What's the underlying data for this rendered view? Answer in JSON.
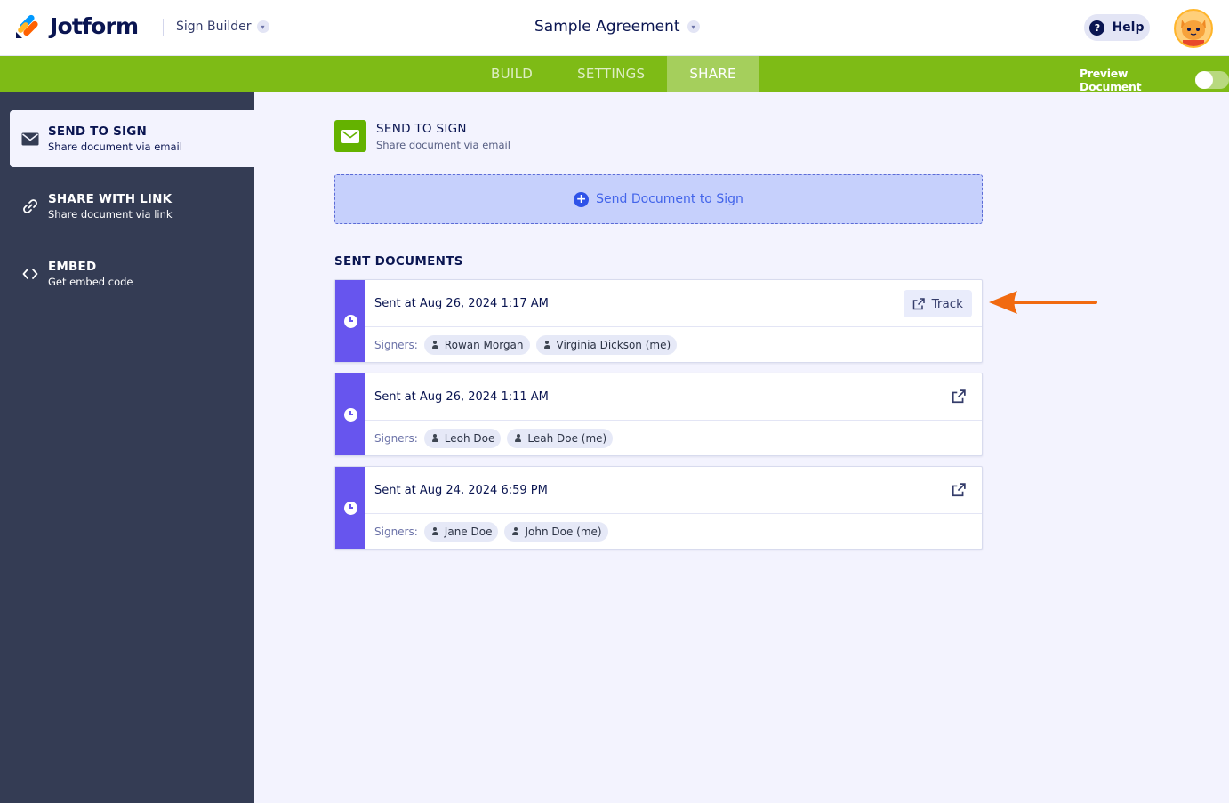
{
  "header": {
    "brand": "Jotform",
    "product": "Sign Builder",
    "document_title": "Sample Agreement",
    "help_label": "Help",
    "avatar_icon": "user-avatar-icon"
  },
  "nav": {
    "tabs": [
      {
        "label": "BUILD",
        "active": false
      },
      {
        "label": "SETTINGS",
        "active": false
      },
      {
        "label": "SHARE",
        "active": true
      }
    ],
    "preview_label": "Preview Document",
    "preview_on": false
  },
  "sidebar": {
    "items": [
      {
        "title": "SEND TO SIGN",
        "subtitle": "Share document via email",
        "icon": "envelope-icon",
        "active": true
      },
      {
        "title": "SHARE WITH LINK",
        "subtitle": "Share document via link",
        "icon": "link-icon",
        "active": false
      },
      {
        "title": "EMBED",
        "subtitle": "Get embed code",
        "icon": "code-icon",
        "active": false
      }
    ]
  },
  "main": {
    "section_title": "SEND TO SIGN",
    "section_subtitle": "Share document via email",
    "send_button_label": "Send Document to Sign",
    "sent_documents_title": "SENT DOCUMENTS",
    "signers_label": "Signers:",
    "track_label": "Track",
    "documents": [
      {
        "sent_at": "Sent at Aug 26, 2024 1:17 AM",
        "signers": [
          "Rowan Morgan",
          "Virginia Dickson (me)"
        ]
      },
      {
        "sent_at": "Sent at Aug 26, 2024 1:11 AM",
        "signers": [
          "Leoh Doe",
          "Leah Doe (me)"
        ]
      },
      {
        "sent_at": "Sent at Aug 24, 2024 6:59 PM",
        "signers": [
          "Jane Doe",
          "John Doe (me)"
        ]
      }
    ]
  },
  "colors": {
    "brand_green": "#7ebb16",
    "sidebar_bg": "#343c54",
    "status_purple": "#6755ee",
    "annotation_arrow": "#f16a10"
  }
}
